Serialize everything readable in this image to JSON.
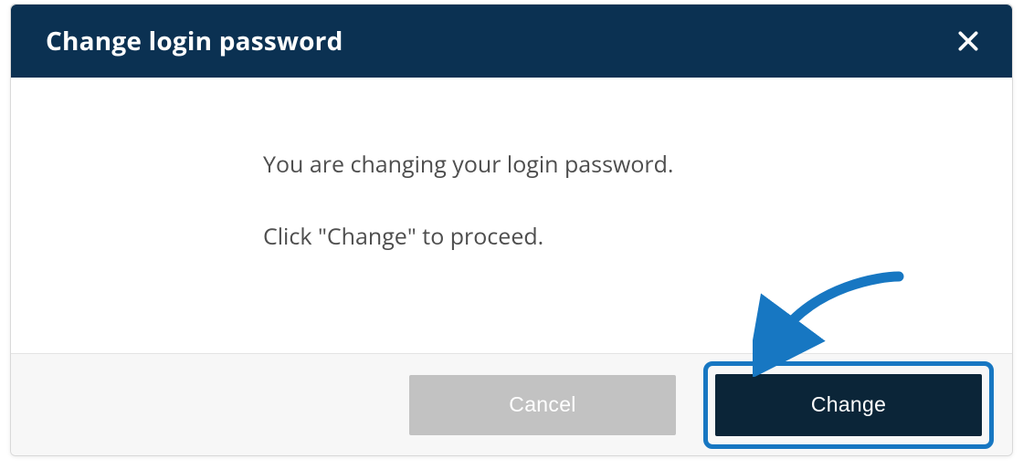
{
  "dialog": {
    "title": "Change login password",
    "body_line1": "You are changing your login password.",
    "body_line2": "Click \"Change\" to proceed."
  },
  "footer": {
    "cancel_label": "Cancel",
    "change_label": "Change"
  },
  "colors": {
    "header_bg": "#0b3152",
    "accent": "#1777c2",
    "cancel_bg": "#c2c2c2",
    "change_bg": "#0b2538"
  }
}
